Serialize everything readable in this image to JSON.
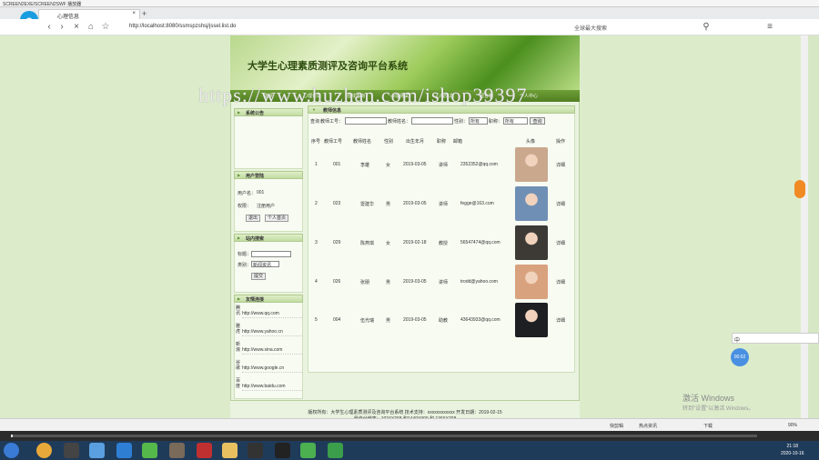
{
  "player": {
    "title": "SCREEN2EXE/SCREEN2SWF 播放器"
  },
  "browser": {
    "tab_label": "心理信息",
    "url": "http://localhost:8080/ssmspzshsj/jssel.list.do",
    "search_placeholder": "全球最大搜索",
    "logo_letter": "e"
  },
  "site": {
    "title": "大学生心理素质测评及咨询平台系统",
    "watermark": "https://www.huzhan.com/ishop39397",
    "menu": [
      "首页",
      "心理论坛",
      "在线咨询",
      "心理测试",
      "心理信息",
      "留言板",
      "个人中心"
    ]
  },
  "sidebar": {
    "notice_title": "系统公告",
    "user_title": "用户登陆",
    "user": {
      "name_label": "用户名：",
      "name_value": "001",
      "role_label": "权限：",
      "role_value": "注册用户",
      "logout": "退出",
      "profile": "个人首页"
    },
    "search_title": "站内搜索",
    "search": {
      "title_label": "标题：",
      "type_label": "类别：",
      "type_value": "新闻资讯",
      "submit": "提交"
    },
    "links_title": "友情连接",
    "links": [
      {
        "icon": "腾讯",
        "url": "http://www.qq.com"
      },
      {
        "icon": "雅虎",
        "url": "http://www.yahoo.cn"
      },
      {
        "icon": "新浪",
        "url": "http://www.sina.com"
      },
      {
        "icon": "谷歌",
        "url": "http://www.google.cn"
      },
      {
        "icon": "百度",
        "url": "http://www.baidu.com"
      }
    ]
  },
  "main": {
    "title": "教师信息",
    "query": {
      "label": "查询",
      "no_label": "教师工号：",
      "name_label": "教师姓名：",
      "gender_label": "性别：",
      "gender_value": "所有",
      "title_label": "职称：",
      "title_value": "所有",
      "button": "查询"
    },
    "columns": [
      "序号",
      "教师工号",
      "教师姓名",
      "性别",
      "出生年月",
      "职称",
      "邮箱",
      "头像",
      "操作"
    ],
    "rows": [
      {
        "idx": "1",
        "no": "001",
        "name": "李雄",
        "gender": "女",
        "birth": "2019-03-05",
        "title": "讲师",
        "email": "2352352@qq.com",
        "action": "详细"
      },
      {
        "idx": "2",
        "no": "023",
        "name": "雷建华",
        "gender": "男",
        "birth": "2019-03-05",
        "title": "讲师",
        "email": "fegge@163.com",
        "action": "详细"
      },
      {
        "idx": "3",
        "no": "029",
        "name": "陈燕琪",
        "gender": "女",
        "birth": "2019-02-18",
        "title": "教授",
        "email": "56547474@qq.com",
        "action": "详细"
      },
      {
        "idx": "4",
        "no": "026",
        "name": "张朋",
        "gender": "男",
        "birth": "2019-03-05",
        "title": "讲师",
        "email": "trodd@yahoo.com",
        "action": "详细"
      },
      {
        "idx": "5",
        "no": "004",
        "name": "伍光瑞",
        "gender": "男",
        "birth": "2019-03-05",
        "title": "助教",
        "email": "43643933@qq.com",
        "action": "详细"
      }
    ],
    "photo_colors": [
      "#caa88e",
      "#6f8fb4",
      "#3d3a35",
      "#d9a27e",
      "#1d1f22"
    ]
  },
  "footer": {
    "line1": "版权所有：大学生心理素质测评及咨询平台系统 技术支持：xxxxxxxxxxxx 开发日期：2019-02-15",
    "line2": "最佳分辨率：1024X768 和1440X900 和 1366X768"
  },
  "os": {
    "activation_title": "激活 Windows",
    "activation_sub": "转到\"设置\"以激活 Windows。",
    "time": "21:18",
    "date": "2020-10-16",
    "ime": "中",
    "timer": "00:02",
    "status_items": [
      "快剪辑",
      "热点资讯",
      "下载",
      "90%"
    ]
  }
}
